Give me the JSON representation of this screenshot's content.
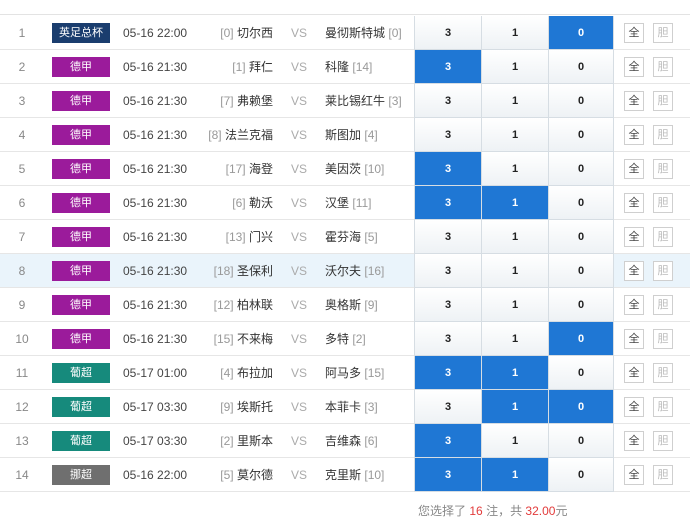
{
  "matches": [
    {
      "no": "1",
      "league": "英足总杯",
      "league_color": "#1a3d6e",
      "time": "05-16 22:00",
      "home_rank": "[0]",
      "home": "切尔西",
      "vs": "VS",
      "away": "曼彻斯特城",
      "away_rank": "[0]",
      "odds": [
        "3",
        "1",
        "0"
      ],
      "selected": [
        false,
        false,
        true
      ],
      "all_label": "全",
      "dan_label": "胆",
      "highlight": false
    },
    {
      "no": "2",
      "league": "德甲",
      "league_color": "#9b1b9b",
      "time": "05-16 21:30",
      "home_rank": "[1]",
      "home": "拜仁",
      "vs": "VS",
      "away": "科隆",
      "away_rank": "[14]",
      "odds": [
        "3",
        "1",
        "0"
      ],
      "selected": [
        true,
        false,
        false
      ],
      "all_label": "全",
      "dan_label": "胆",
      "highlight": false
    },
    {
      "no": "3",
      "league": "德甲",
      "league_color": "#9b1b9b",
      "time": "05-16 21:30",
      "home_rank": "[7]",
      "home": "弗赖堡",
      "vs": "VS",
      "away": "莱比锡红牛",
      "away_rank": "[3]",
      "odds": [
        "3",
        "1",
        "0"
      ],
      "selected": [
        false,
        false,
        false
      ],
      "all_label": "全",
      "dan_label": "胆",
      "highlight": false
    },
    {
      "no": "4",
      "league": "德甲",
      "league_color": "#9b1b9b",
      "time": "05-16 21:30",
      "home_rank": "[8]",
      "home": "法兰克福",
      "vs": "VS",
      "away": "斯图加",
      "away_rank": "[4]",
      "odds": [
        "3",
        "1",
        "0"
      ],
      "selected": [
        false,
        false,
        false
      ],
      "all_label": "全",
      "dan_label": "胆",
      "highlight": false
    },
    {
      "no": "5",
      "league": "德甲",
      "league_color": "#9b1b9b",
      "time": "05-16 21:30",
      "home_rank": "[17]",
      "home": "海登",
      "vs": "VS",
      "away": "美因茨",
      "away_rank": "[10]",
      "odds": [
        "3",
        "1",
        "0"
      ],
      "selected": [
        true,
        false,
        false
      ],
      "all_label": "全",
      "dan_label": "胆",
      "highlight": false
    },
    {
      "no": "6",
      "league": "德甲",
      "league_color": "#9b1b9b",
      "time": "05-16 21:30",
      "home_rank": "[6]",
      "home": "勒沃",
      "vs": "VS",
      "away": "汉堡",
      "away_rank": "[11]",
      "odds": [
        "3",
        "1",
        "0"
      ],
      "selected": [
        true,
        true,
        false
      ],
      "all_label": "全",
      "dan_label": "胆",
      "highlight": false
    },
    {
      "no": "7",
      "league": "德甲",
      "league_color": "#9b1b9b",
      "time": "05-16 21:30",
      "home_rank": "[13]",
      "home": "门兴",
      "vs": "VS",
      "away": "霍芬海",
      "away_rank": "[5]",
      "odds": [
        "3",
        "1",
        "0"
      ],
      "selected": [
        false,
        false,
        false
      ],
      "all_label": "全",
      "dan_label": "胆",
      "highlight": false
    },
    {
      "no": "8",
      "league": "德甲",
      "league_color": "#9b1b9b",
      "time": "05-16 21:30",
      "home_rank": "[18]",
      "home": "圣保利",
      "vs": "VS",
      "away": "沃尔夫",
      "away_rank": "[16]",
      "odds": [
        "3",
        "1",
        "0"
      ],
      "selected": [
        false,
        false,
        false
      ],
      "all_label": "全",
      "dan_label": "胆",
      "highlight": true
    },
    {
      "no": "9",
      "league": "德甲",
      "league_color": "#9b1b9b",
      "time": "05-16 21:30",
      "home_rank": "[12]",
      "home": "柏林联",
      "vs": "VS",
      "away": "奥格斯",
      "away_rank": "[9]",
      "odds": [
        "3",
        "1",
        "0"
      ],
      "selected": [
        false,
        false,
        false
      ],
      "all_label": "全",
      "dan_label": "胆",
      "highlight": false
    },
    {
      "no": "10",
      "league": "德甲",
      "league_color": "#9b1b9b",
      "time": "05-16 21:30",
      "home_rank": "[15]",
      "home": "不来梅",
      "vs": "VS",
      "away": "多特",
      "away_rank": "[2]",
      "odds": [
        "3",
        "1",
        "0"
      ],
      "selected": [
        false,
        false,
        true
      ],
      "all_label": "全",
      "dan_label": "胆",
      "highlight": false
    },
    {
      "no": "11",
      "league": "葡超",
      "league_color": "#168a7c",
      "time": "05-17 01:00",
      "home_rank": "[4]",
      "home": "布拉加",
      "vs": "VS",
      "away": "阿马多",
      "away_rank": "[15]",
      "odds": [
        "3",
        "1",
        "0"
      ],
      "selected": [
        true,
        true,
        false
      ],
      "all_label": "全",
      "dan_label": "胆",
      "highlight": false
    },
    {
      "no": "12",
      "league": "葡超",
      "league_color": "#168a7c",
      "time": "05-17 03:30",
      "home_rank": "[9]",
      "home": "埃斯托",
      "vs": "VS",
      "away": "本菲卡",
      "away_rank": "[3]",
      "odds": [
        "3",
        "1",
        "0"
      ],
      "selected": [
        false,
        true,
        true
      ],
      "all_label": "全",
      "dan_label": "胆",
      "highlight": false
    },
    {
      "no": "13",
      "league": "葡超",
      "league_color": "#168a7c",
      "time": "05-17 03:30",
      "home_rank": "[2]",
      "home": "里斯本",
      "vs": "VS",
      "away": "吉维森",
      "away_rank": "[6]",
      "odds": [
        "3",
        "1",
        "0"
      ],
      "selected": [
        true,
        false,
        false
      ],
      "all_label": "全",
      "dan_label": "胆",
      "highlight": false
    },
    {
      "no": "14",
      "league": "挪超",
      "league_color": "#6f6f6f",
      "time": "05-16 22:00",
      "home_rank": "[5]",
      "home": "莫尔德",
      "vs": "VS",
      "away": "克里斯",
      "away_rank": "[10]",
      "odds": [
        "3",
        "1",
        "0"
      ],
      "selected": [
        true,
        true,
        false
      ],
      "all_label": "全",
      "dan_label": "胆",
      "highlight": false
    }
  ],
  "summary": {
    "prefix": "您选择了",
    "count": "16",
    "mid": "注，共",
    "amount": "32.00",
    "suffix": "元"
  }
}
